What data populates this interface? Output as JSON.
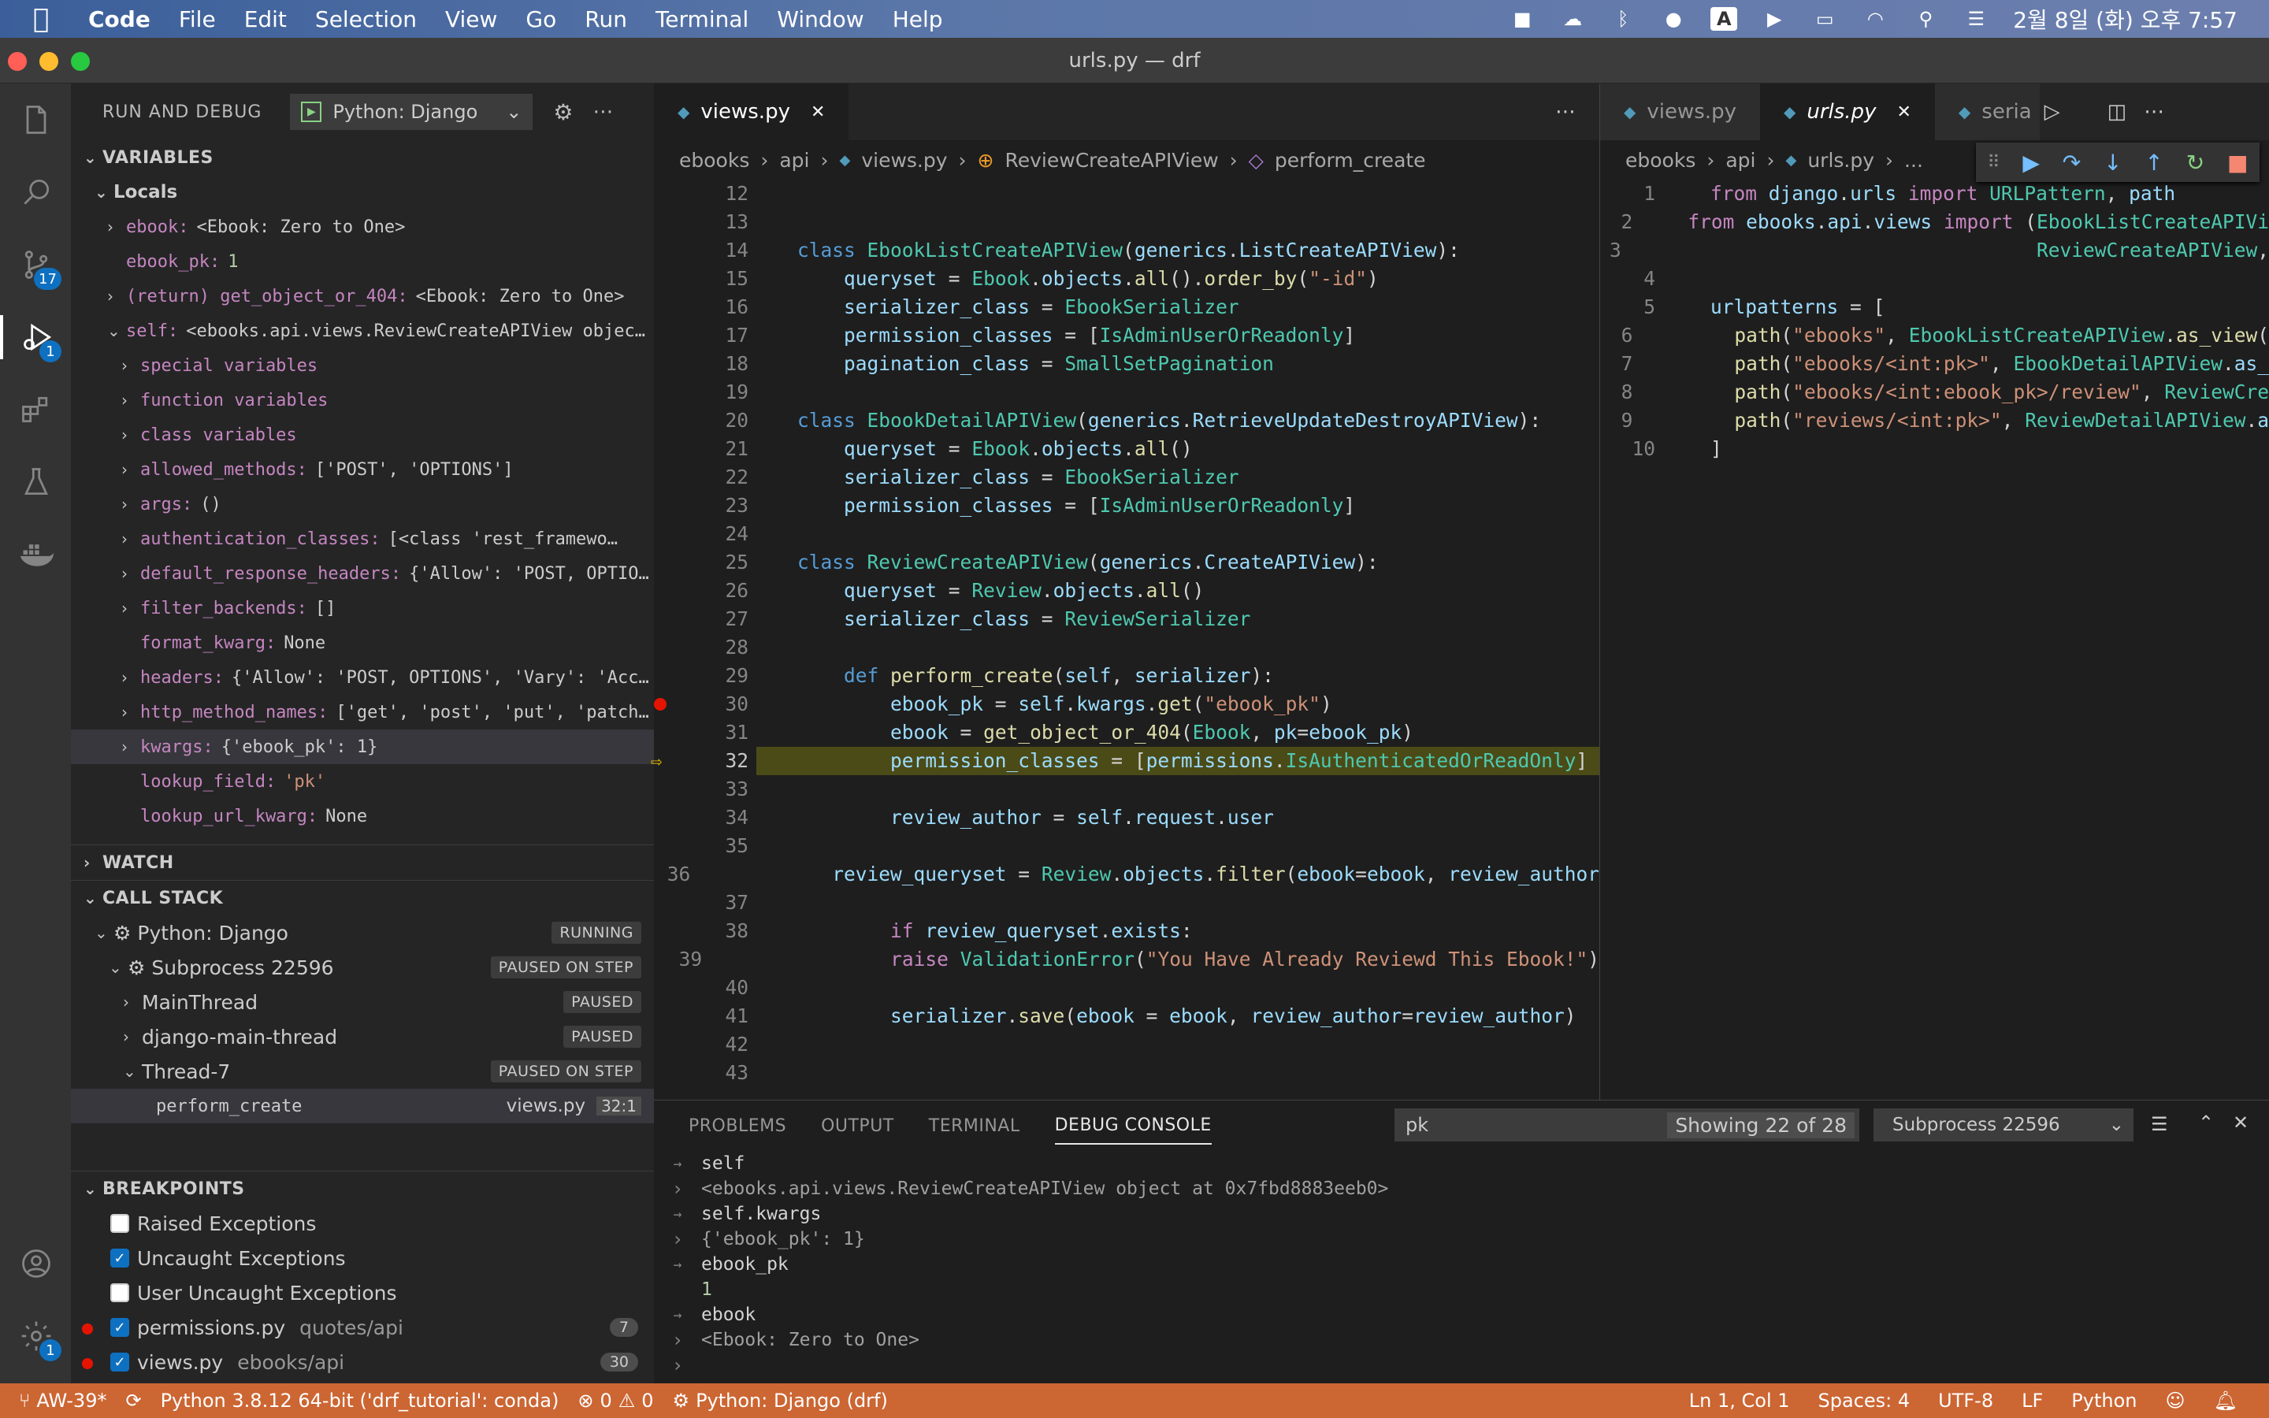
{
  "menubar": {
    "app": "Code",
    "items": [
      "File",
      "Edit",
      "Selection",
      "View",
      "Go",
      "Run",
      "Terminal",
      "Window",
      "Help"
    ],
    "clock": "2월 8일 (화) 오후 7:57",
    "tray_icons": [
      "camera-icon",
      "cloud-icon",
      "bluetooth-icon",
      "chat-icon",
      "text-input-icon",
      "play-icon",
      "battery-icon",
      "wifi-icon",
      "search-icon",
      "control-center-icon"
    ]
  },
  "window": {
    "title": "urls.py — drf"
  },
  "activity": {
    "scm_badge": "17",
    "debug_badge": "1",
    "settings_badge": "1"
  },
  "sidebar": {
    "title": "RUN AND DEBUG",
    "config": "Python: Django",
    "variables": {
      "header": "VARIABLES",
      "locals": "Locals",
      "items": [
        {
          "indent": 1,
          "chev": "›",
          "name": "ebook:",
          "value": "<Ebook: Zero to One>",
          "cls": "vval"
        },
        {
          "indent": 1,
          "chev": "",
          "name": "ebook_pk:",
          "value": "1",
          "cls": "vnum"
        },
        {
          "indent": 1,
          "chev": "›",
          "name": "(return) get_object_or_404:",
          "value": "<Ebook: Zero to One>",
          "cls": "vval"
        },
        {
          "indent": 1,
          "chev": "⌄",
          "name": "self:",
          "value": "<ebooks.api.views.ReviewCreateAPIView objec…",
          "cls": "vval"
        },
        {
          "indent": 2,
          "chev": "›",
          "name": "special variables",
          "value": "",
          "cls": "vval"
        },
        {
          "indent": 2,
          "chev": "›",
          "name": "function variables",
          "value": "",
          "cls": "vval"
        },
        {
          "indent": 2,
          "chev": "›",
          "name": "class variables",
          "value": "",
          "cls": "vval"
        },
        {
          "indent": 2,
          "chev": "›",
          "name": "allowed_methods:",
          "value": "['POST', 'OPTIONS']",
          "cls": "vval"
        },
        {
          "indent": 2,
          "chev": "›",
          "name": "args:",
          "value": "()",
          "cls": "vval"
        },
        {
          "indent": 2,
          "chev": "›",
          "name": "authentication_classes:",
          "value": "[<class 'rest_framewo…",
          "cls": "vval"
        },
        {
          "indent": 2,
          "chev": "›",
          "name": "default_response_headers:",
          "value": "{'Allow': 'POST, OPTIO…",
          "cls": "vval"
        },
        {
          "indent": 2,
          "chev": "›",
          "name": "filter_backends:",
          "value": "[]",
          "cls": "vval"
        },
        {
          "indent": 2,
          "chev": "",
          "name": "format_kwarg:",
          "value": "None",
          "cls": "vval"
        },
        {
          "indent": 2,
          "chev": "›",
          "name": "headers:",
          "value": "{'Allow': 'POST, OPTIONS', 'Vary': 'Acc…",
          "cls": "vval"
        },
        {
          "indent": 2,
          "chev": "›",
          "name": "http_method_names:",
          "value": "['get', 'post', 'put', 'patch…",
          "cls": "vval"
        },
        {
          "indent": 2,
          "chev": "›",
          "name": "kwargs:",
          "value": "{'ebook_pk': 1}",
          "cls": "vval",
          "selected": true
        },
        {
          "indent": 2,
          "chev": "",
          "name": "lookup_field:",
          "value": "'pk'",
          "cls": "vstr"
        },
        {
          "indent": 2,
          "chev": "",
          "name": "lookup_url_kwarg:",
          "value": "None",
          "cls": "vval"
        }
      ]
    },
    "watch": "WATCH",
    "callstack": {
      "header": "CALL STACK",
      "items": [
        {
          "indent": 1,
          "chev": "⌄",
          "gear": true,
          "label": "Python: Django",
          "badge": "RUNNING"
        },
        {
          "indent": 2,
          "chev": "⌄",
          "gear": true,
          "label": "Subprocess 22596",
          "badge": "PAUSED ON STEP"
        },
        {
          "indent": 3,
          "chev": "›",
          "gear": false,
          "label": "MainThread",
          "badge": "PAUSED"
        },
        {
          "indent": 3,
          "chev": "›",
          "gear": false,
          "label": "django-main-thread",
          "badge": "PAUSED"
        },
        {
          "indent": 3,
          "chev": "⌄",
          "gear": false,
          "label": "Thread-7",
          "badge": "PAUSED ON STEP"
        }
      ],
      "frame": {
        "fn": "perform_create",
        "file": "views.py",
        "pos": "32:1"
      }
    },
    "breakpoints": {
      "header": "BREAKPOINTS",
      "items": [
        {
          "label": "Raised Exceptions",
          "checked": false,
          "dot": false,
          "path": "",
          "count": ""
        },
        {
          "label": "Uncaught Exceptions",
          "checked": true,
          "dot": false,
          "path": "",
          "count": ""
        },
        {
          "label": "User Uncaught Exceptions",
          "checked": false,
          "dot": false,
          "path": "",
          "count": ""
        },
        {
          "label": "permissions.py",
          "checked": true,
          "dot": true,
          "path": "quotes/api",
          "count": "7"
        },
        {
          "label": "views.py",
          "checked": true,
          "dot": true,
          "path": "ebooks/api",
          "count": "30"
        }
      ]
    }
  },
  "editor1": {
    "tab": "views.py",
    "crumbs": [
      "ebooks",
      "api",
      "views.py",
      "ReviewCreateAPIView",
      "perform_create"
    ],
    "lines": [
      {
        "n": "12",
        "t": ""
      },
      {
        "n": "13",
        "t": ""
      },
      {
        "n": "14",
        "t": "class EbookListCreateAPIView(generics.ListCreateAPIView):"
      },
      {
        "n": "15",
        "t": "    queryset = Ebook.objects.all().order_by(\"-id\")"
      },
      {
        "n": "16",
        "t": "    serializer_class = EbookSerializer"
      },
      {
        "n": "17",
        "t": "    permission_classes = [IsAdminUserOrReadonly]"
      },
      {
        "n": "18",
        "t": "    pagination_class = SmallSetPagination"
      },
      {
        "n": "19",
        "t": ""
      },
      {
        "n": "20",
        "t": "class EbookDetailAPIView(generics.RetrieveUpdateDestroyAPIView):"
      },
      {
        "n": "21",
        "t": "    queryset = Ebook.objects.all()"
      },
      {
        "n": "22",
        "t": "    serializer_class = EbookSerializer"
      },
      {
        "n": "23",
        "t": "    permission_classes = [IsAdminUserOrReadonly]"
      },
      {
        "n": "24",
        "t": ""
      },
      {
        "n": "25",
        "t": "class ReviewCreateAPIView(generics.CreateAPIView):"
      },
      {
        "n": "26",
        "t": "    queryset = Review.objects.all()"
      },
      {
        "n": "27",
        "t": "    serializer_class = ReviewSerializer"
      },
      {
        "n": "28",
        "t": ""
      },
      {
        "n": "29",
        "t": "    def perform_create(self, serializer):"
      },
      {
        "n": "30",
        "t": "        ebook_pk = self.kwargs.get(\"ebook_pk\")",
        "bp": true
      },
      {
        "n": "31",
        "t": "        ebook = get_object_or_404(Ebook, pk=ebook_pk)"
      },
      {
        "n": "32",
        "t": "        permission_classes = [permissions.IsAuthenticatedOrReadOnly]",
        "cur": true
      },
      {
        "n": "33",
        "t": ""
      },
      {
        "n": "34",
        "t": "        review_author = self.request.user"
      },
      {
        "n": "35",
        "t": ""
      },
      {
        "n": "36",
        "t": "        review_queryset = Review.objects.filter(ebook=ebook, review_author"
      },
      {
        "n": "37",
        "t": ""
      },
      {
        "n": "38",
        "t": "        if review_queryset.exists:"
      },
      {
        "n": "39",
        "t": "            raise ValidationError(\"You Have Already Reviewd This Ebook!\")"
      },
      {
        "n": "40",
        "t": ""
      },
      {
        "n": "41",
        "t": "        serializer.save(ebook = ebook, review_author=review_author)"
      },
      {
        "n": "42",
        "t": ""
      },
      {
        "n": "43",
        "t": ""
      }
    ]
  },
  "editor2": {
    "tabs": [
      "views.py",
      "urls.py",
      "seria"
    ],
    "crumbs": [
      "ebooks",
      "api",
      "urls.py",
      "..."
    ],
    "lines": [
      {
        "n": "1",
        "t": "from django.urls import URLPattern, path"
      },
      {
        "n": "2",
        "t": "from ebooks.api.views import (EbookListCreateAPIVi"
      },
      {
        "n": "3",
        "t": "                               ReviewCreateAPIView,"
      },
      {
        "n": "4",
        "t": ""
      },
      {
        "n": "5",
        "t": "urlpatterns = ["
      },
      {
        "n": "6",
        "t": "    path(\"ebooks\", EbookListCreateAPIView.as_view("
      },
      {
        "n": "7",
        "t": "    path(\"ebooks/<int:pk>\", EbookDetailAPIView.as_"
      },
      {
        "n": "8",
        "t": "    path(\"ebooks/<int:ebook_pk>/review\", ReviewCre"
      },
      {
        "n": "9",
        "t": "    path(\"reviews/<int:pk>\", ReviewDetailAPIView.a"
      },
      {
        "n": "10",
        "t": "]"
      }
    ]
  },
  "panel": {
    "tabs": [
      "PROBLEMS",
      "OUTPUT",
      "TERMINAL",
      "DEBUG CONSOLE"
    ],
    "filter": "pk",
    "filter_count": "Showing 22 of 28",
    "process": "Subprocess 22596",
    "console": [
      {
        "arrow": "→",
        "text": "self",
        "cls": "pl"
      },
      {
        "arrow": "›",
        "text": "<ebooks.api.views.ReviewCreateAPIView object at 0x7fbd8883eeb0>",
        "cls": "out"
      },
      {
        "arrow": "→",
        "text": "self.kwargs",
        "cls": "pl"
      },
      {
        "arrow": "›",
        "text": "{'ebook_pk': 1}",
        "cls": "out"
      },
      {
        "arrow": "→",
        "text": "ebook_pk",
        "cls": "pl"
      },
      {
        "arrow": "",
        "text": "1",
        "cls": "num"
      },
      {
        "arrow": "→",
        "text": "ebook",
        "cls": "pl"
      },
      {
        "arrow": "›",
        "text": "<Ebook: Zero to One>",
        "cls": "out"
      }
    ],
    "prompt": "›"
  },
  "status": {
    "branch": "AW-39*",
    "python": "Python 3.8.12 64-bit ('drf_tutorial': conda)",
    "errors": "0",
    "warnings": "0",
    "debug": "Python: Django (drf)",
    "right": [
      "Ln 1, Col 1",
      "Spaces: 4",
      "UTF-8",
      "LF",
      "Python"
    ]
  }
}
